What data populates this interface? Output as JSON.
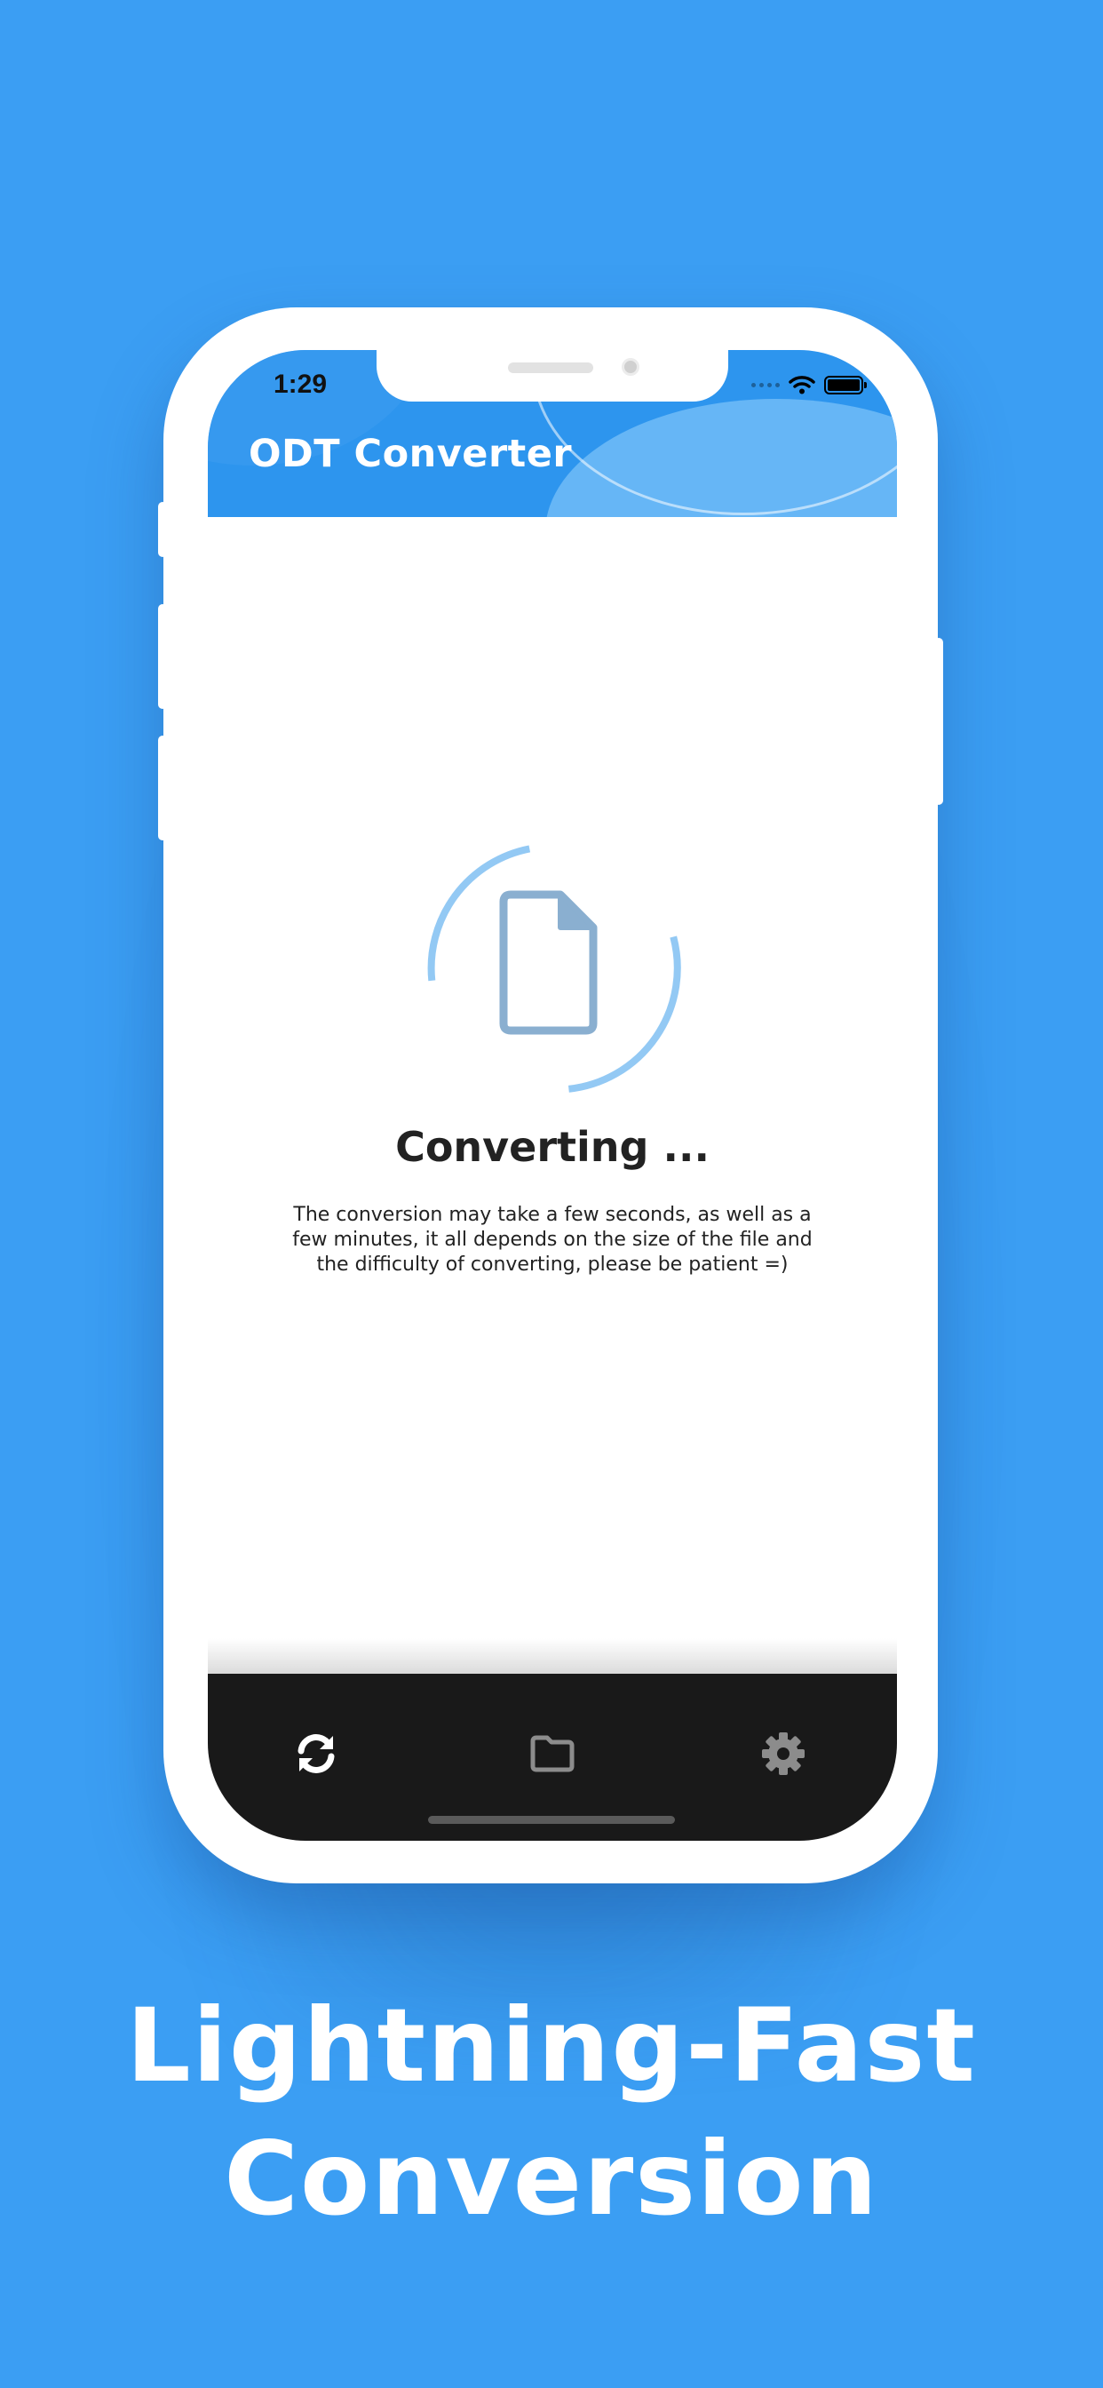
{
  "status_bar": {
    "time": "1:29"
  },
  "app": {
    "title": "ODT Converter"
  },
  "main": {
    "converting_title": "Converting ...",
    "description": "The conversion may take a few seconds, as well as a few minutes, it all depends on the size of the file and the difficulty of converting, please be patient =)"
  },
  "tab_bar": {
    "tabs": [
      {
        "icon": "sync-icon",
        "active": true
      },
      {
        "icon": "folder-icon",
        "active": false
      },
      {
        "icon": "gear-icon",
        "active": false
      }
    ]
  },
  "marketing": {
    "headline_line1": "Lightning-Fast",
    "headline_line2": "Conversion"
  },
  "colors": {
    "background": "#3b9ef3",
    "header": "#2d95ee",
    "loader_arc": "#93c9f4",
    "document_icon": "#8aafd0",
    "tab_bar": "#191919"
  }
}
